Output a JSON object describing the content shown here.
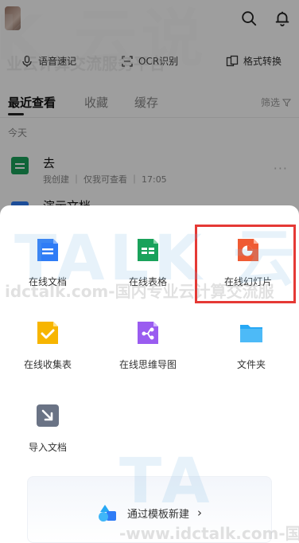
{
  "header": {
    "toolbar": {
      "voice_note": "语音速记",
      "ocr": "OCR识别",
      "format_convert": "格式转换"
    }
  },
  "tabs": {
    "recent": "最近查看",
    "favorites": "收藏",
    "cache": "缓存",
    "filter": "筛选"
  },
  "list": {
    "section_today": "今天",
    "items": [
      {
        "title": "去",
        "meta": "我创建 ｜ 仅我可查看 ｜ 17:05"
      },
      {
        "title": "演示文档"
      }
    ]
  },
  "sheet": {
    "items": [
      {
        "label": "在线文档",
        "icon": "doc-icon",
        "color": "#2f7cf6"
      },
      {
        "label": "在线表格",
        "icon": "sheet-icon",
        "color": "#1aa25b"
      },
      {
        "label": "在线幻灯片",
        "icon": "slides-icon",
        "color": "#ef5b33"
      },
      {
        "label": "在线收集表",
        "icon": "form-icon",
        "color": "#f7b500"
      },
      {
        "label": "在线思维导图",
        "icon": "mindmap-icon",
        "color": "#9a5cf0"
      },
      {
        "label": "文件夹",
        "icon": "folder-icon",
        "color": "#27a8f5"
      },
      {
        "label": "导入文档",
        "icon": "import-icon",
        "color": "#6a7385"
      }
    ],
    "template_link": "通过模板新建"
  },
  "watermark": {
    "line1": "idctalk.com-国内专业云计算交流服",
    "line2": "-www.idctalk.com-国",
    "top_line": "业云计算交流服务平台",
    "logo_top": "K 云说",
    "logo_mid": "TALK 云",
    "logo_bottom": "TA"
  }
}
